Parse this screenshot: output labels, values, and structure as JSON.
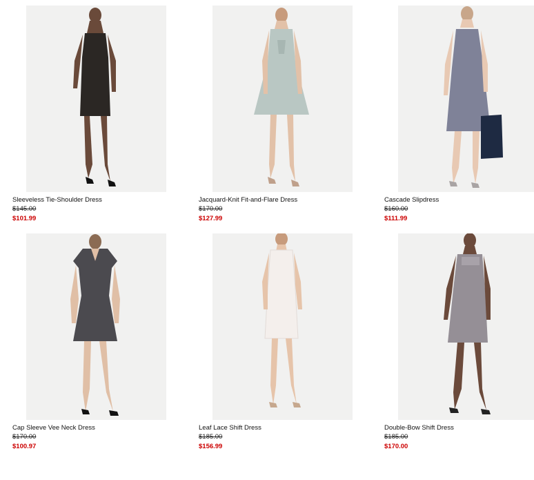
{
  "products": [
    {
      "name": "Sleeveless Tie-Shoulder Dress",
      "original_price": "$145.00",
      "sale_price": "$101.99",
      "dress_color": "#2b2724",
      "skin": "#6a4a3a",
      "image": "model-photo"
    },
    {
      "name": "Jacquard-Knit Fit-and-Flare Dress",
      "original_price": "$170.00",
      "sale_price": "$127.99",
      "dress_color": "#b9c7c3",
      "skin": "#e2c1a8",
      "image": "model-photo"
    },
    {
      "name": "Cascade Slipdress",
      "original_price": "$160.00",
      "sale_price": "$111.99",
      "dress_color": "#7f8298",
      "skin": "#e8c9b3",
      "image": "model-photo"
    },
    {
      "name": "Cap Sleeve Vee Neck Dress",
      "original_price": "$170.00",
      "sale_price": "$100.97",
      "dress_color": "#4b4a4f",
      "skin": "#e0bfa6",
      "image": "model-photo"
    },
    {
      "name": "Leaf Lace Shift Dress",
      "original_price": "$185.00",
      "sale_price": "$156.99",
      "dress_color": "#f4efec",
      "skin": "#e6c4aa",
      "image": "model-photo"
    },
    {
      "name": "Double-Bow Shift Dress",
      "original_price": "$185.00",
      "sale_price": "$170.00",
      "dress_color": "#958f96",
      "skin": "#6b4a3b",
      "image": "model-photo"
    }
  ],
  "colors": {
    "sale": "#cc0000",
    "image_bg": "#f1f1f0"
  }
}
